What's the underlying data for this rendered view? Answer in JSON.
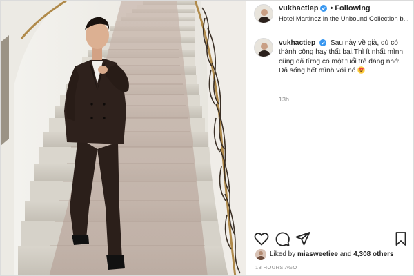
{
  "post": {
    "username": "vukhactiep",
    "follow_status": "Following",
    "location": "Hotel Martinez in the Unbound Collection b...",
    "caption": "Sau này về già, dù có thành công hay thất bại.Thì ít nhất mình cũng đã từng có một tuổi trẻ đáng nhớ. Đã sống hết mình với nó",
    "caption_time": "13h",
    "likes_prefix": "Liked by",
    "liked_by_user": "miasweetiee",
    "likes_and": "and",
    "likes_count": "4,308 others",
    "posted_time": "13 HOURS AGO"
  },
  "colors": {
    "verified_badge": "#3897f0",
    "text_primary": "#262626",
    "text_secondary": "#8e8e8e",
    "border": "#dbdbdb"
  },
  "icons": {
    "verified": "verified-badge-icon",
    "like": "heart-icon",
    "comment": "comment-icon",
    "share": "paper-plane-icon",
    "save": "bookmark-icon",
    "emoji": "heart-eyes-emoji"
  }
}
